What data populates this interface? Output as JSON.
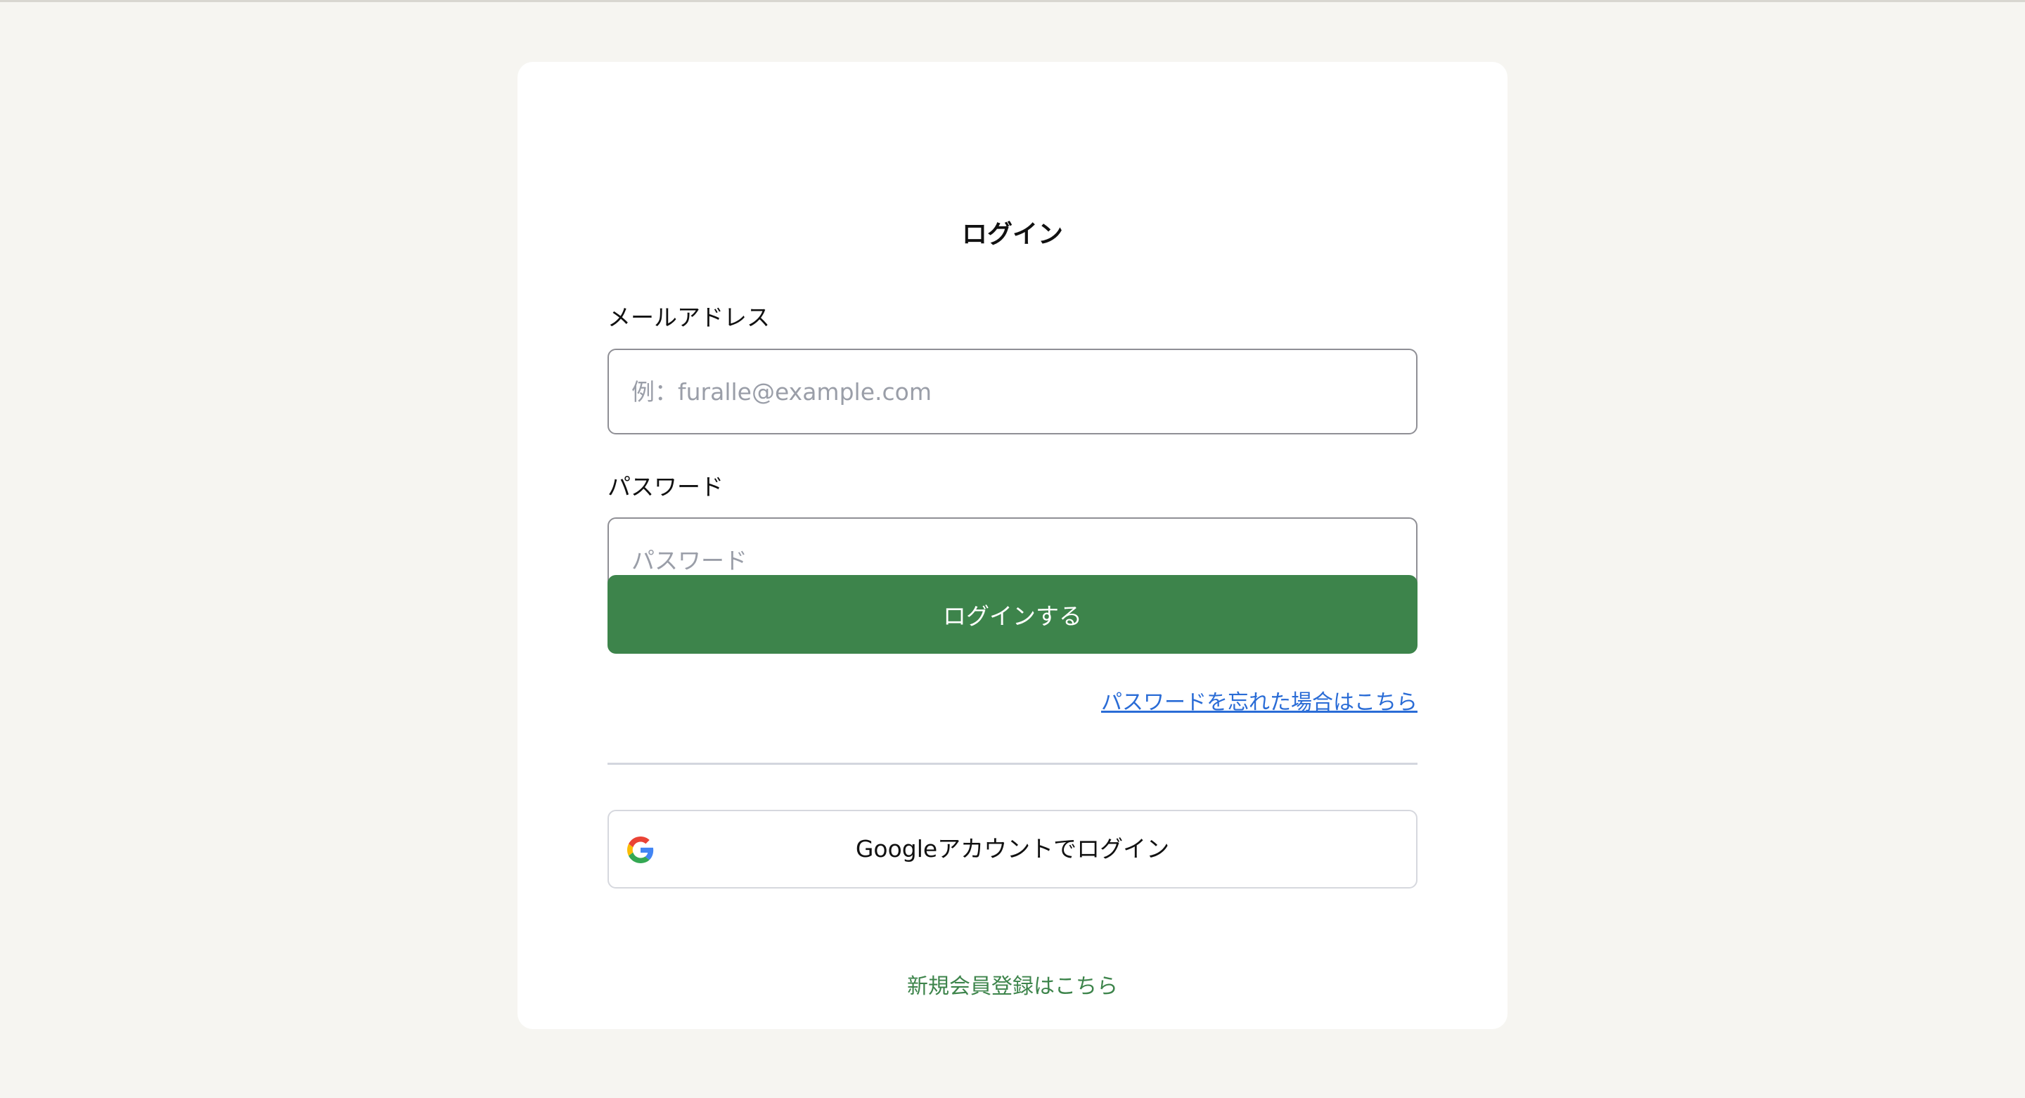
{
  "page": {
    "background_color": "#f6f5f1",
    "accent_color": "#3d844b",
    "link_color": "#2a6cd6"
  },
  "login_form": {
    "title": "ログイン",
    "email": {
      "label": "メールアドレス",
      "value": "",
      "placeholder": "例：furalle@example.com"
    },
    "password": {
      "label": "パスワード",
      "value": "",
      "placeholder": "パスワード"
    },
    "submit_label": "ログインする",
    "forgot_password_link": "パスワードを忘れた場合はこちら",
    "google_login": {
      "icon": "google-g-icon",
      "label": "Googleアカウントでログイン"
    },
    "signup_link": "新規会員登録はこちら"
  }
}
